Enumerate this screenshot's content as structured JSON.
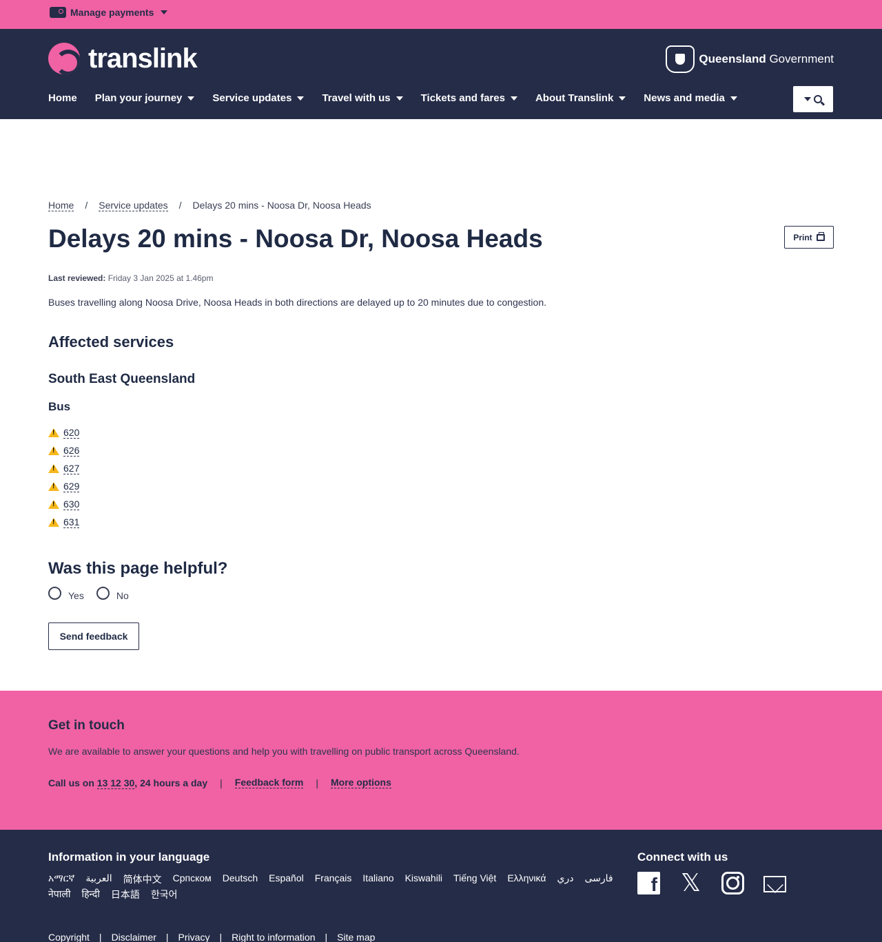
{
  "topbar": {
    "manage_payments": "Manage payments"
  },
  "header": {
    "logo_text": "translink",
    "gov_bold": "Queensland",
    "gov_rest": " Government",
    "nav": [
      {
        "label": "Home",
        "has_caret": false
      },
      {
        "label": "Plan your journey",
        "has_caret": true
      },
      {
        "label": "Service updates",
        "has_caret": true
      },
      {
        "label": "Travel with us",
        "has_caret": true
      },
      {
        "label": "Tickets and fares",
        "has_caret": true
      },
      {
        "label": "About Translink",
        "has_caret": true
      },
      {
        "label": "News and media",
        "has_caret": true
      }
    ]
  },
  "breadcrumb": {
    "home": "Home",
    "sep1": "/",
    "service_updates": "Service updates",
    "sep2": "/",
    "current": "Delays 20 mins - Noosa Dr, Noosa Heads"
  },
  "page": {
    "title": "Delays 20 mins - Noosa Dr, Noosa Heads",
    "print_label": "Print",
    "last_reviewed_label": "Last reviewed:",
    "last_reviewed_value": " Friday 3 Jan 2025 at 1.46pm",
    "description": "Buses travelling along Noosa Drive, Noosa Heads in both directions are delayed up to 20 minutes due to congestion.",
    "affected_heading": "Affected services",
    "region": "South East Queensland",
    "mode": "Bus",
    "routes": [
      "620",
      "626",
      "627",
      "629",
      "630",
      "631"
    ]
  },
  "feedback": {
    "question": "Was this page helpful?",
    "yes": "Yes",
    "no": "No",
    "send": "Send feedback"
  },
  "touch": {
    "title": "Get in touch",
    "desc": "We are available to answer your questions and help you with travelling on public transport across Queensland.",
    "call_prefix": "Call us on ",
    "phone": "13 12 30",
    "call_suffix": ", 24 hours a day",
    "sep": "|",
    "feedback_form": "Feedback form",
    "more_options": "More options"
  },
  "footer": {
    "lang_title": "Information in your language",
    "languages": [
      "አማርኛ",
      "العربية",
      "简体中文",
      "Српском",
      "Deutsch",
      "Español",
      "Français",
      "Italiano",
      "Kiswahili",
      "Tiếng Việt",
      "Ελληνικά",
      "دري",
      "فارسی",
      "नेपाली",
      "हिन्दी",
      "日本語",
      "한국어"
    ],
    "connect_title": "Connect with us",
    "socials": [
      "facebook-icon",
      "x-icon",
      "instagram-icon",
      "email-icon"
    ],
    "legal": [
      "Copyright",
      "Disclaimer",
      "Privacy",
      "Right to information",
      "Site map"
    ],
    "legal_sep": "|"
  },
  "colors": {
    "pink": "#f062a4",
    "navy": "#252c48",
    "warning": "#f7b81b"
  }
}
